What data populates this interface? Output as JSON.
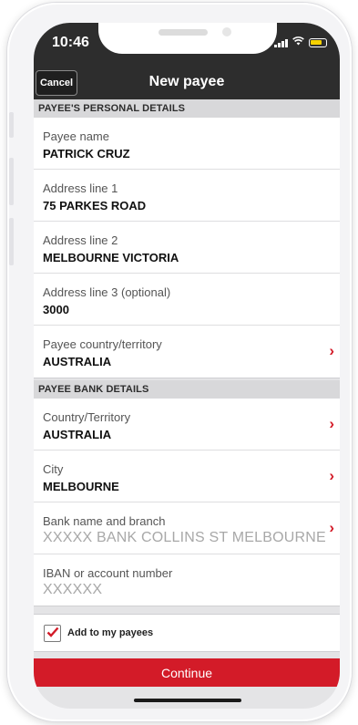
{
  "status": {
    "time": "10:46"
  },
  "nav": {
    "cancel_label": "Cancel",
    "title": "New payee"
  },
  "personal": {
    "header": "PAYEE'S PERSONAL DETAILS",
    "fields": [
      {
        "label": "Payee name",
        "value": "PATRICK CRUZ"
      },
      {
        "label": "Address line 1",
        "value": "75 PARKES ROAD"
      },
      {
        "label": "Address line 2",
        "value": "MELBOURNE VICTORIA"
      },
      {
        "label": "Address line 3 (optional)",
        "value": "3000"
      },
      {
        "label": "Payee country/territory",
        "value": "AUSTRALIA",
        "icon": "chevron-right-icon"
      }
    ]
  },
  "bank": {
    "header": "PAYEE BANK DETAILS",
    "fields": [
      {
        "label": "Country/Territory",
        "value": "AUSTRALIA",
        "icon": "chevron-right-icon"
      },
      {
        "label": "City",
        "value": "MELBOURNE",
        "icon": "chevron-right-icon"
      },
      {
        "label": "Bank name and branch",
        "placeholder": "XXXXX BANK COLLINS ST MELBOURNE",
        "icon": "chevron-right-icon"
      },
      {
        "label": "IBAN or account number",
        "placeholder": "XXXXXX"
      }
    ]
  },
  "add_to_payees": {
    "label": "Add to my payees",
    "checked": true
  },
  "continue_label": "Continue",
  "colors": {
    "accent": "#d31b28",
    "navbar": "#2d2d2d",
    "section_header": "#d8d8da"
  }
}
